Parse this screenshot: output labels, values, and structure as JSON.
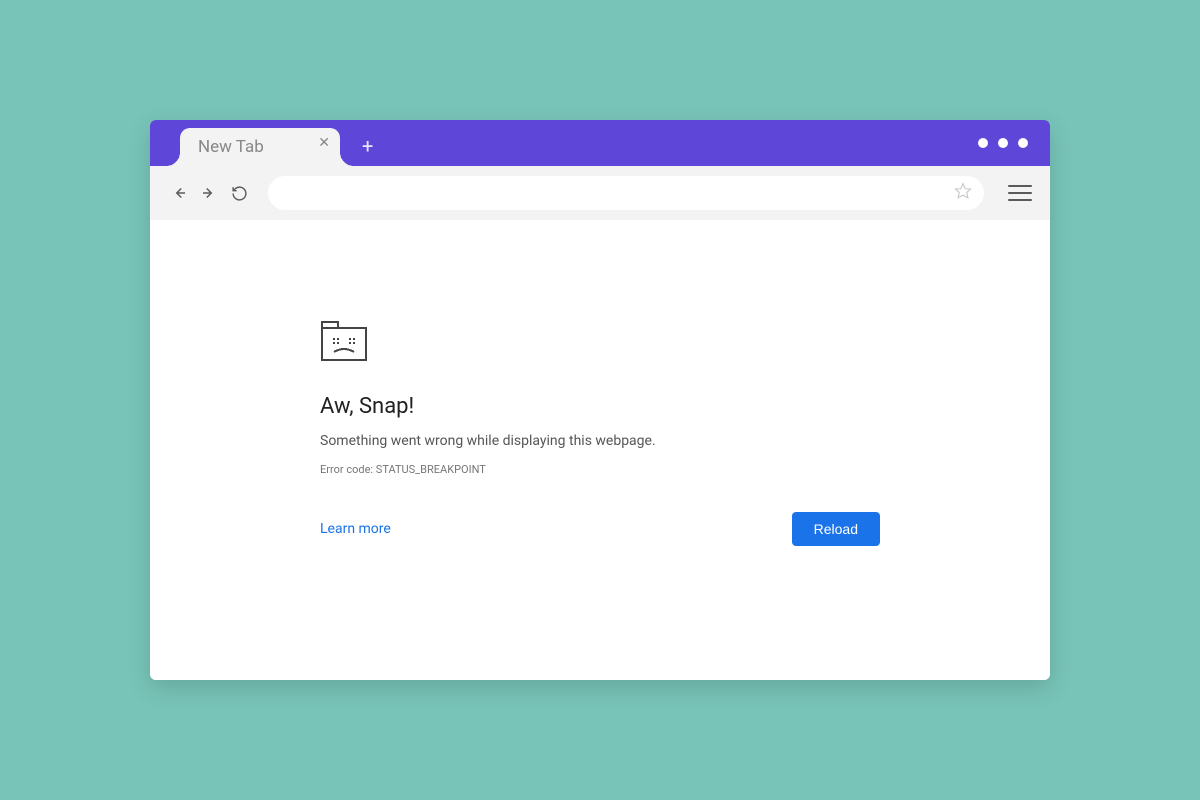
{
  "tab": {
    "title": "New Tab"
  },
  "error": {
    "title": "Aw, Snap!",
    "message": "Something went wrong while displaying this webpage.",
    "code": "Error code: STATUS_BREAKPOINT",
    "learn_more": "Learn more",
    "reload": "Reload"
  }
}
